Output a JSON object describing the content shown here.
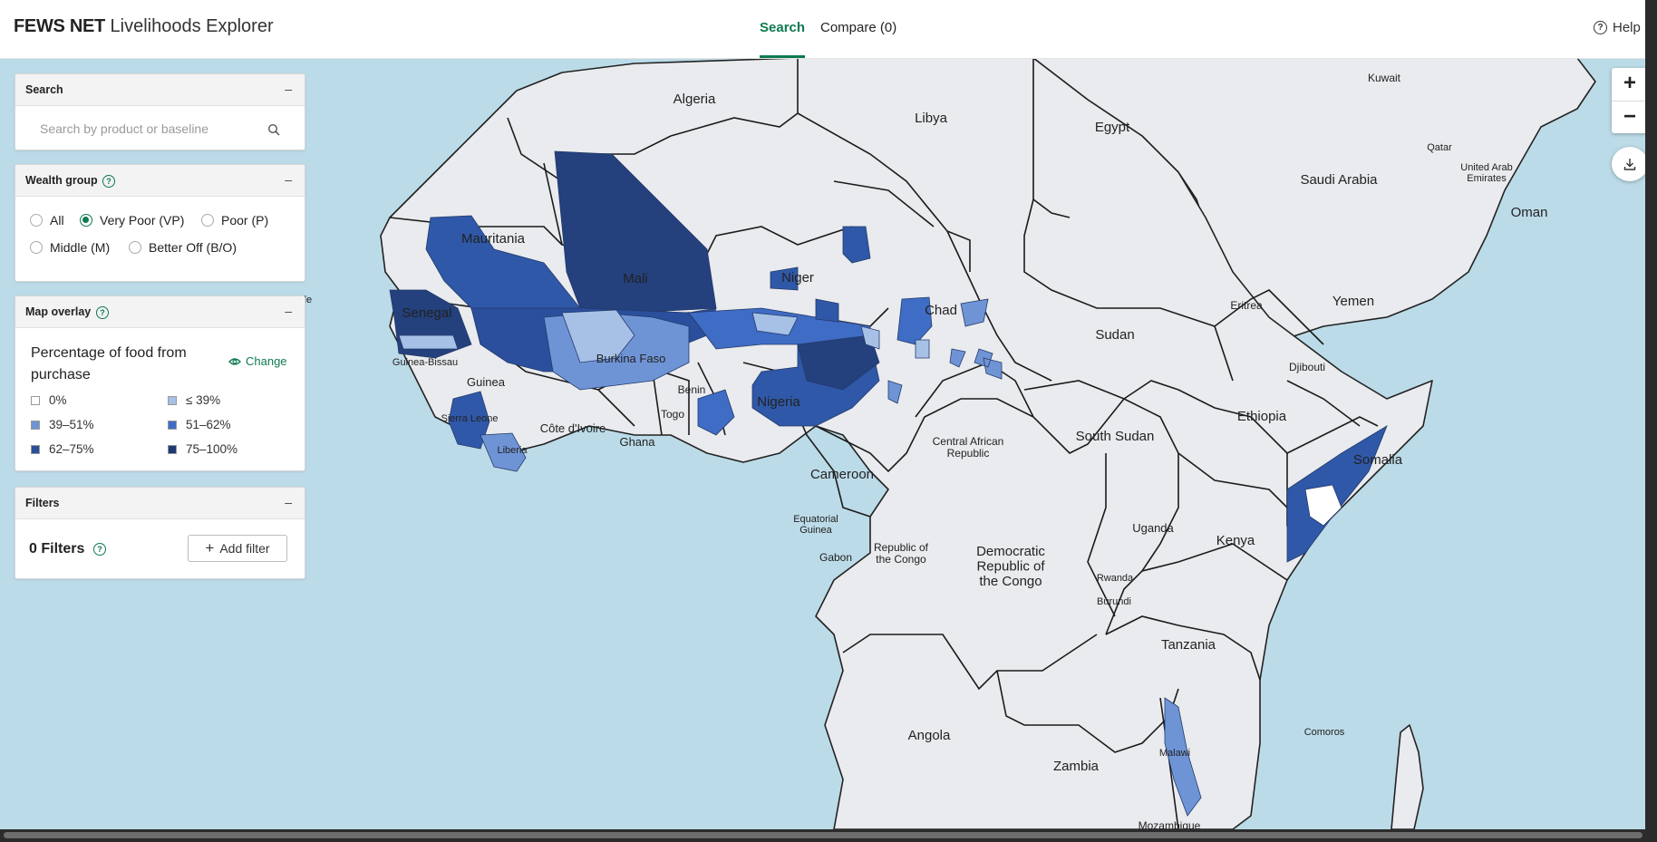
{
  "app": {
    "brand_bold": "FEWS NET",
    "brand_rest": "Livelihoods Explorer"
  },
  "nav": {
    "search": "Search",
    "compare": "Compare (0)",
    "help": "Help"
  },
  "search_panel": {
    "title": "Search",
    "placeholder": "Search by product or baseline",
    "collapse": "–"
  },
  "wealth_panel": {
    "title": "Wealth group",
    "collapse": "–",
    "options": [
      "All",
      "Very Poor (VP)",
      "Poor (P)",
      "Middle (M)",
      "Better Off (B/O)"
    ],
    "selected": "Very Poor (VP)"
  },
  "overlay_panel": {
    "title": "Map overlay",
    "collapse": "–",
    "overlay_title": "Percentage of food from purchase",
    "change": "Change",
    "legend": [
      {
        "label": "0%",
        "color": "#ffffff"
      },
      {
        "label": "≤ 39%",
        "color": "#a7c0e6"
      },
      {
        "label": "39–51%",
        "color": "#6f94d6"
      },
      {
        "label": "51–62%",
        "color": "#3f6cc4"
      },
      {
        "label": "62–75%",
        "color": "#2b4f9c"
      },
      {
        "label": "75–100%",
        "color": "#1f3a72"
      }
    ]
  },
  "filters_panel": {
    "title": "Filters",
    "collapse": "–",
    "count_label": "0 Filters",
    "add": "Add filter"
  },
  "map_controls": {
    "zoom_in": "+",
    "zoom_out": "−"
  },
  "map_labels": {
    "algeria": "Algeria",
    "libya": "Libya",
    "egypt": "Egypt",
    "kuwait": "Kuwait",
    "qatar": "Qatar",
    "uae": "United Arab\nEmirates",
    "saudi": "Saudi Arabia",
    "oman": "Oman",
    "yemen": "Yemen",
    "eritrea": "Eritrea",
    "djibouti": "Djibouti",
    "ethiopia": "Ethiopia",
    "somalia": "Somalia",
    "mauritania": "Mauritania",
    "mali": "Mali",
    "niger": "Niger",
    "chad": "Chad",
    "sudan": "Sudan",
    "senegal": "Senegal",
    "guinea_bissau": "Guinea-Bissau",
    "guinea": "Guinea",
    "burkina": "Burkina Faso",
    "benin": "Benin",
    "togo": "Togo",
    "nigeria": "Nigeria",
    "ghana": "Ghana",
    "cote": "Côte d'Ivoire",
    "liberia": "Liberia",
    "sierra_leone": "Sierra Leone",
    "car": "Central African\nRepublic",
    "south_sudan": "South Sudan",
    "cameroon": "Cameroon",
    "eq_guinea": "Equatorial\nGuinea",
    "gabon": "Gabon",
    "congo": "Republic of\nthe Congo",
    "drc": "Democratic\nRepublic of\nthe Congo",
    "uganda": "Uganda",
    "kenya": "Kenya",
    "rwanda": "Rwanda",
    "burundi": "Burundi",
    "tanzania": "Tanzania",
    "angola": "Angola",
    "zambia": "Zambia",
    "malawi": "Malawi",
    "mozambique": "Mozambique",
    "comoros": "Comoros",
    "cabo": "de"
  }
}
